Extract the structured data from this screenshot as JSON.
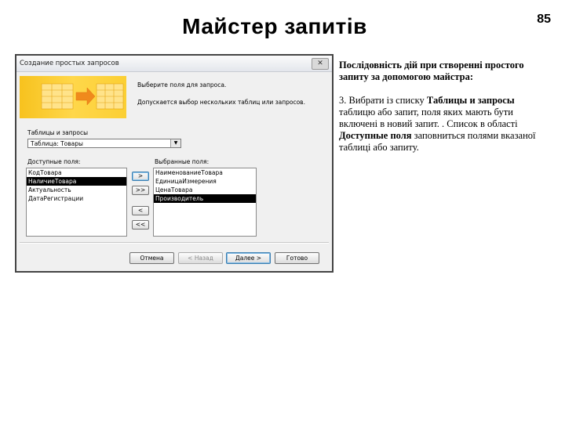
{
  "slide": {
    "title": "Майстер запитів",
    "page_number": "85"
  },
  "dialog": {
    "title": "Создание простых запросов",
    "close_symbol": "✕",
    "hint_fields": "Выберите поля для запроса.",
    "hint_multi": "Допускается выбор нескольких таблиц или запросов.",
    "tables_label": "Таблицы и запросы",
    "tables_selected": "Таблица: Товары",
    "available_label": "Доступные поля:",
    "available_fields": [
      "КодТовара",
      "НаличиеТовара",
      "Актуальность",
      "ДатаРегистрации"
    ],
    "available_selected_index": 1,
    "selected_label": "Выбранные поля:",
    "selected_fields": [
      "НаименованиеТовара",
      "ЕдиницаИзмерения",
      "ЦенаТовара",
      "Производитель"
    ],
    "selected_selected_index": 3,
    "move_buttons": [
      ">",
      ">>",
      "<",
      "<<"
    ],
    "buttons": {
      "cancel": "Отмена",
      "back": "< Назад",
      "next": "Далее >",
      "finish": "Готово"
    },
    "banner_colors": {
      "banner": "#f7c21e",
      "grid": "#ffe38a",
      "arrow": "#f08a1c"
    }
  },
  "steps": {
    "heading": "Послідовність дій при створенні простого запиту за допомогою майстра:",
    "step_num": "3. Вибрати із списку ",
    "step_bold1": "Таблицы и запросы",
    "step_text1": " таблицю або запит, поля яких мають бути включені в новий запит. . Список в області ",
    "step_bold2": "Доступные поля",
    "step_text2": " заповниться полями вказаної таблиці або запиту."
  }
}
